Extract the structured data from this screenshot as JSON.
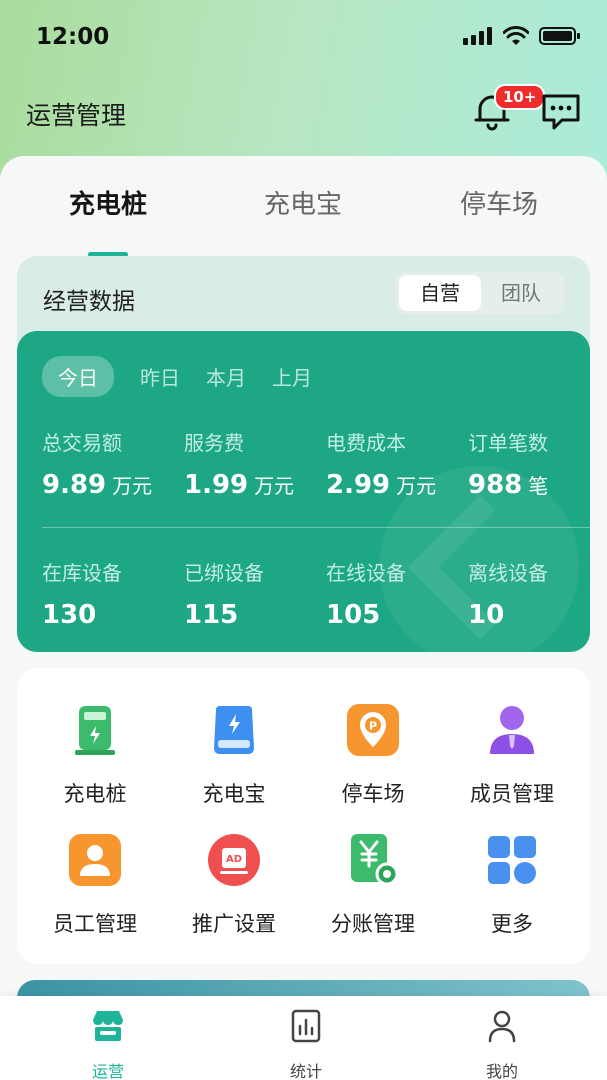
{
  "status_bar": {
    "time": "12:00"
  },
  "header": {
    "title": "运营管理",
    "notification_badge": "10+"
  },
  "tabs": [
    {
      "label": "充电桩",
      "active": true
    },
    {
      "label": "充电宝",
      "active": false
    },
    {
      "label": "停车场",
      "active": false
    }
  ],
  "business": {
    "title": "经营数据",
    "segments": [
      {
        "label": "自营",
        "active": true
      },
      {
        "label": "团队",
        "active": false
      }
    ],
    "periods": [
      {
        "label": "今日",
        "active": true
      },
      {
        "label": "昨日",
        "active": false
      },
      {
        "label": "本月",
        "active": false
      },
      {
        "label": "上月",
        "active": false
      }
    ],
    "stats_row1": [
      {
        "label": "总交易额",
        "value": "9.89",
        "unit": "万元"
      },
      {
        "label": "服务费",
        "value": "1.99",
        "unit": "万元"
      },
      {
        "label": "电费成本",
        "value": "2.99",
        "unit": "万元"
      },
      {
        "label": "订单笔数",
        "value": "988",
        "unit": "笔"
      }
    ],
    "stats_row2": [
      {
        "label": "在库设备",
        "value": "130"
      },
      {
        "label": "已绑设备",
        "value": "115"
      },
      {
        "label": "在线设备",
        "value": "105"
      },
      {
        "label": "离线设备",
        "value": "10"
      }
    ]
  },
  "menu": [
    {
      "label": "充电桩",
      "icon": "charging-pile-icon"
    },
    {
      "label": "充电宝",
      "icon": "power-bank-icon"
    },
    {
      "label": "停车场",
      "icon": "parking-icon"
    },
    {
      "label": "成员管理",
      "icon": "member-icon"
    },
    {
      "label": "员工管理",
      "icon": "staff-icon"
    },
    {
      "label": "推广设置",
      "icon": "ad-icon"
    },
    {
      "label": "分账管理",
      "icon": "split-bill-icon"
    },
    {
      "label": "更多",
      "icon": "more-icon"
    }
  ],
  "bottom_nav": [
    {
      "label": "运营",
      "icon": "store-icon",
      "active": true
    },
    {
      "label": "统计",
      "icon": "chart-icon",
      "active": false
    },
    {
      "label": "我的",
      "icon": "user-icon",
      "active": false
    }
  ],
  "colors": {
    "accent": "#1fb39a",
    "panel": "#1ea784",
    "badge": "#ef2c2c"
  }
}
